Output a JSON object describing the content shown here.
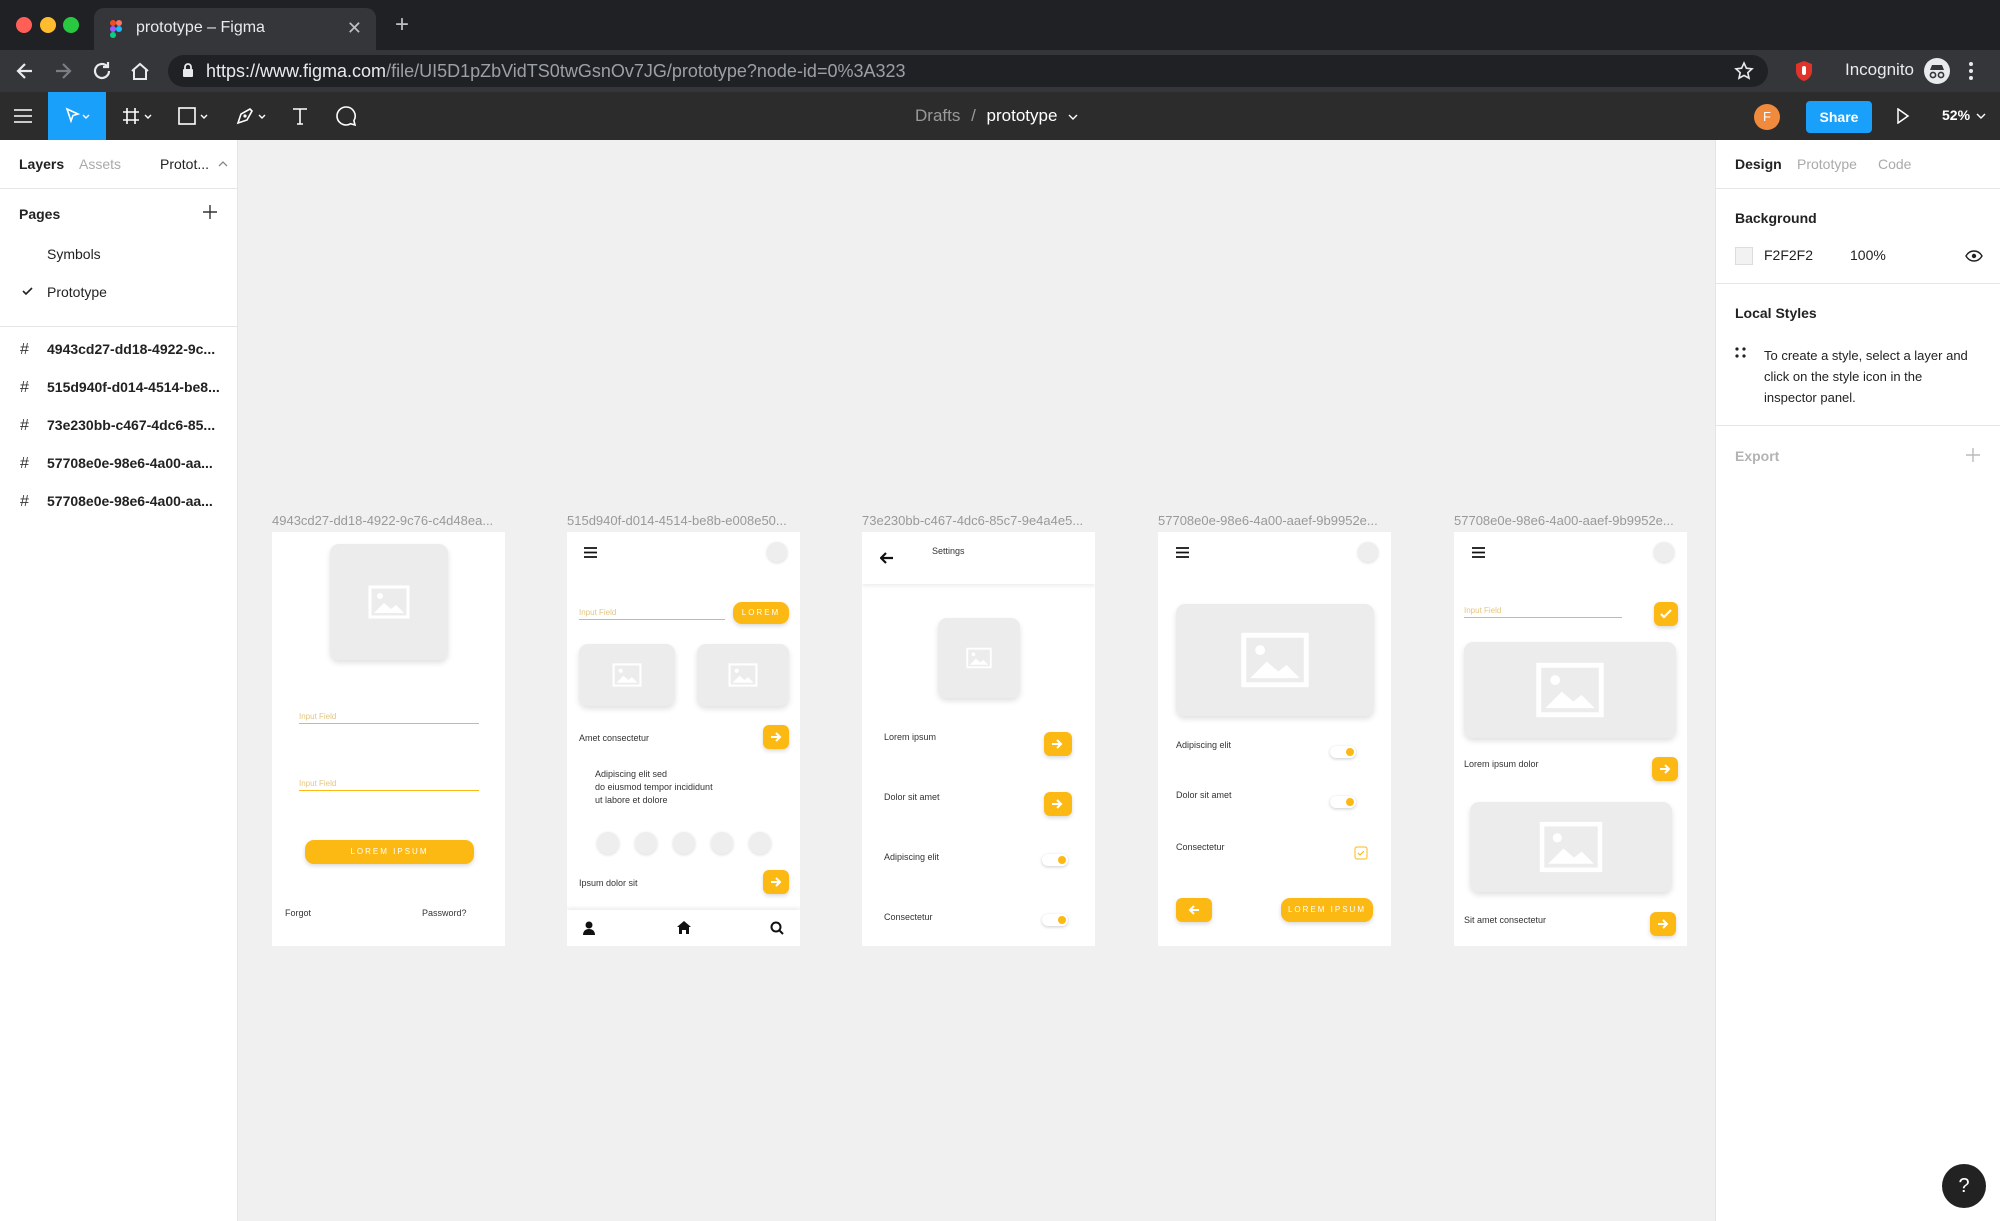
{
  "browser": {
    "tab_title": "prototype – Figma",
    "url_host": "https://www.figma.com",
    "url_path": "/file/UI5D1pZbVidTS0twGsnOv7JG/prototype?node-id=0%3A323",
    "incognito_label": "Incognito",
    "icons": [
      "figma-favicon",
      "close-tab-icon",
      "new-tab-icon",
      "back-icon",
      "forward-icon",
      "reload-icon",
      "home-icon",
      "lock-icon",
      "bookmark-star-icon",
      "extension-icon",
      "incognito-icon",
      "menu-dots-icon"
    ]
  },
  "toolbar": {
    "breadcrumb_parent": "Drafts",
    "breadcrumb_sep": "/",
    "file_name": "prototype",
    "avatar_initial": "F",
    "share_label": "Share",
    "zoom": "52%",
    "accent": "#18a0fb"
  },
  "left_panel": {
    "tabs": [
      "Layers",
      "Assets",
      "Protot..."
    ],
    "pages_heading": "Pages",
    "pages": [
      {
        "label": "Symbols",
        "selected": false
      },
      {
        "label": "Prototype",
        "selected": true
      }
    ],
    "layers": [
      "4943cd27-dd18-4922-9c...",
      "515d940f-d014-4514-be8...",
      "73e230bb-c467-4dc6-85...",
      "57708e0e-98e6-4a00-aa...",
      "57708e0e-98e6-4a00-aa..."
    ]
  },
  "canvas": {
    "brand_yellow": "#fdb913",
    "frames": [
      {
        "label": "4943cd27-dd18-4922-9c76-c4d48ea...",
        "input1": "Input Field",
        "input2": "Input Field",
        "button": "LOREM IPSUM",
        "forgot": "Forgot",
        "password": "Password?"
      },
      {
        "label": "515d940f-d014-4514-be8b-e008e50...",
        "input": "Input Field",
        "button": "LOREM",
        "row1": "Amet consectetur",
        "paragraph": [
          "Adipiscing elit sed",
          "do eiusmod tempor incididunt",
          "ut labore et dolore"
        ],
        "row2": "Ipsum dolor sit"
      },
      {
        "label": "73e230bb-c467-4dc6-85c7-9e4a4e5...",
        "title": "Settings",
        "rows": [
          "Lorem ipsum",
          "Dolor sit amet",
          "Adipiscing elit",
          "Consectetur"
        ]
      },
      {
        "label": "57708e0e-98e6-4a00-aaef-9b9952e...",
        "rows": [
          "Adipiscing elit",
          "Dolor sit amet",
          "Consectetur"
        ],
        "button": "LOREM IPSUM"
      },
      {
        "label": "57708e0e-98e6-4a00-aaef-9b9952e...",
        "input": "Input Field",
        "row1": "Lorem ipsum dolor",
        "row2": "Sit amet consectetur"
      }
    ]
  },
  "right_panel": {
    "tabs": [
      "Design",
      "Prototype",
      "Code"
    ],
    "background_heading": "Background",
    "background_hex": "F2F2F2",
    "background_opacity": "100%",
    "local_styles_heading": "Local Styles",
    "local_styles_help": [
      "To create a style, select a layer and",
      "click on the style icon in the",
      "inspector panel."
    ],
    "export_label": "Export",
    "help_label": "?"
  }
}
